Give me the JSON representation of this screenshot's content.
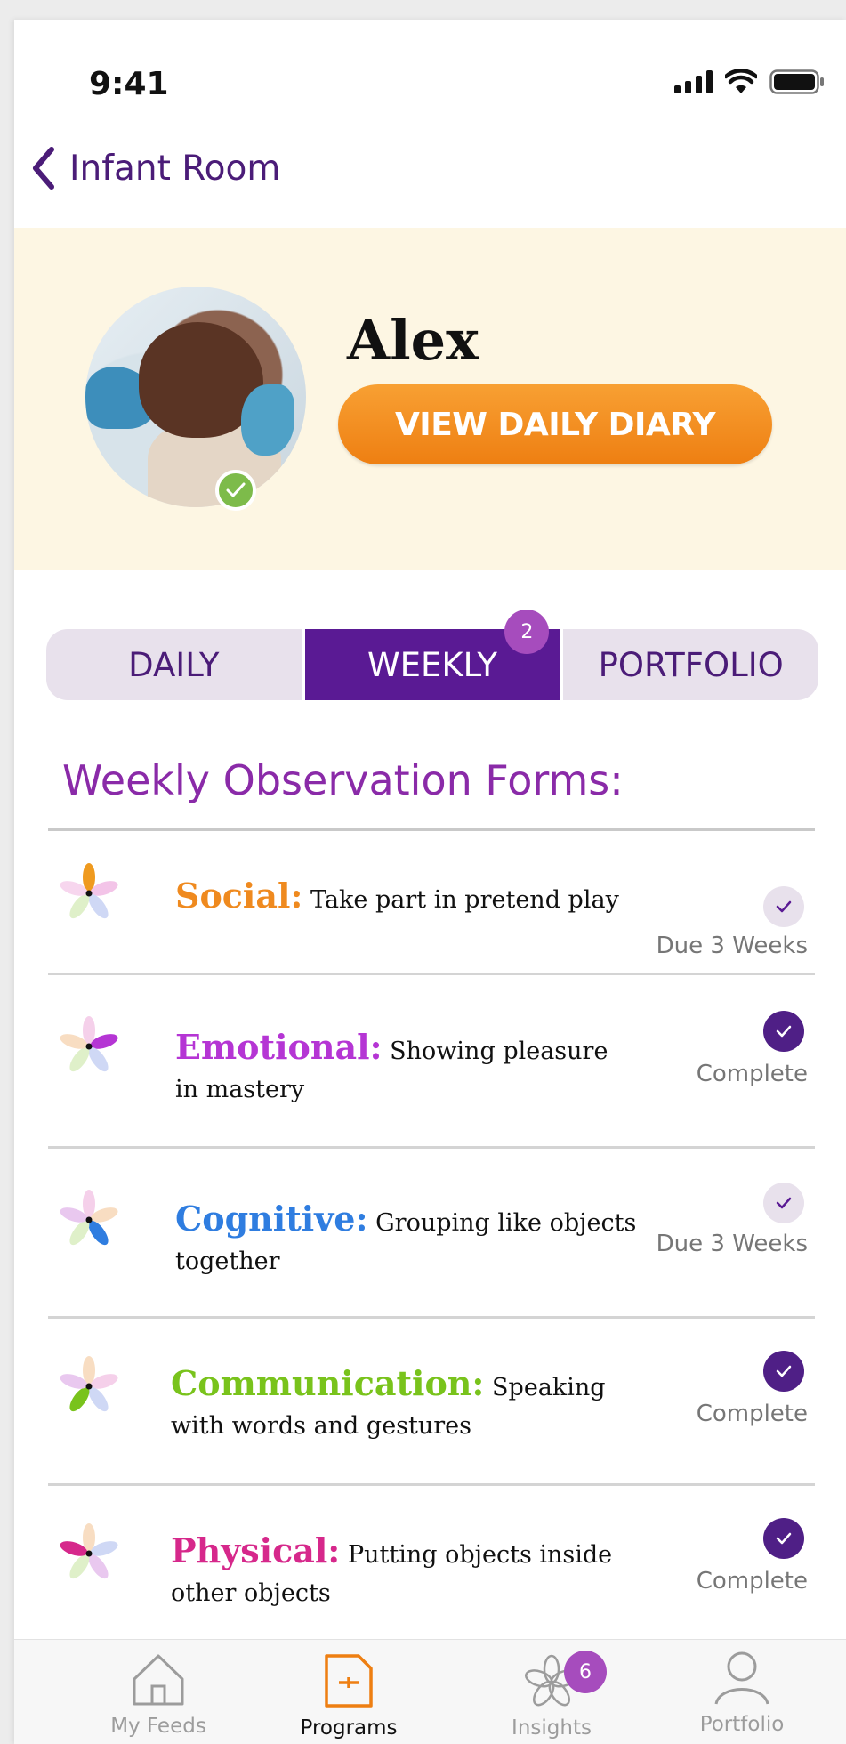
{
  "status_bar": {
    "time": "9:41"
  },
  "nav": {
    "back_label": "Infant Room"
  },
  "profile": {
    "name": "Alex",
    "diary_button": "VIEW DAILY DIARY",
    "status": "checked-in"
  },
  "tabs": [
    {
      "label": "DAILY",
      "active": false
    },
    {
      "label": "WEEKLY",
      "active": true,
      "badge": "2"
    },
    {
      "label": "PORTFOLIO",
      "active": false
    }
  ],
  "section_title": "Weekly Observation Forms:",
  "observations": [
    {
      "category": "Social:",
      "description": "Take part in pretend play",
      "status": "Due 3 Weeks",
      "complete": false,
      "color": "#ef8a1f"
    },
    {
      "category": "Emotional:",
      "description": "Showing pleasure in mastery",
      "status": "Complete",
      "complete": true,
      "color": "#b535d4"
    },
    {
      "category": "Cognitive:",
      "description": "Grouping like objects together",
      "status": "Due 3 Weeks",
      "complete": false,
      "color": "#2f7de0"
    },
    {
      "category": "Communication:",
      "description": "Speaking with words and gestures",
      "status": "Complete",
      "complete": true,
      "color": "#79c31c"
    },
    {
      "category": "Physical:",
      "description": "Putting objects inside other objects",
      "status": "Complete",
      "complete": true,
      "color": "#d6288b"
    }
  ],
  "tab_bar": [
    {
      "label": "My Feeds",
      "icon": "home-icon",
      "active": false
    },
    {
      "label": "Programs",
      "icon": "programs-icon",
      "active": true
    },
    {
      "label": "Insights",
      "icon": "flower-icon",
      "active": false,
      "badge": "6"
    },
    {
      "label": "Portfolio",
      "icon": "person-icon",
      "active": false
    }
  ],
  "colors": {
    "brand_purple": "#5a1a94",
    "accent_orange": "#ee7f12",
    "badge_purple": "#a64cbd",
    "header_cream": "#fdf6e3"
  }
}
